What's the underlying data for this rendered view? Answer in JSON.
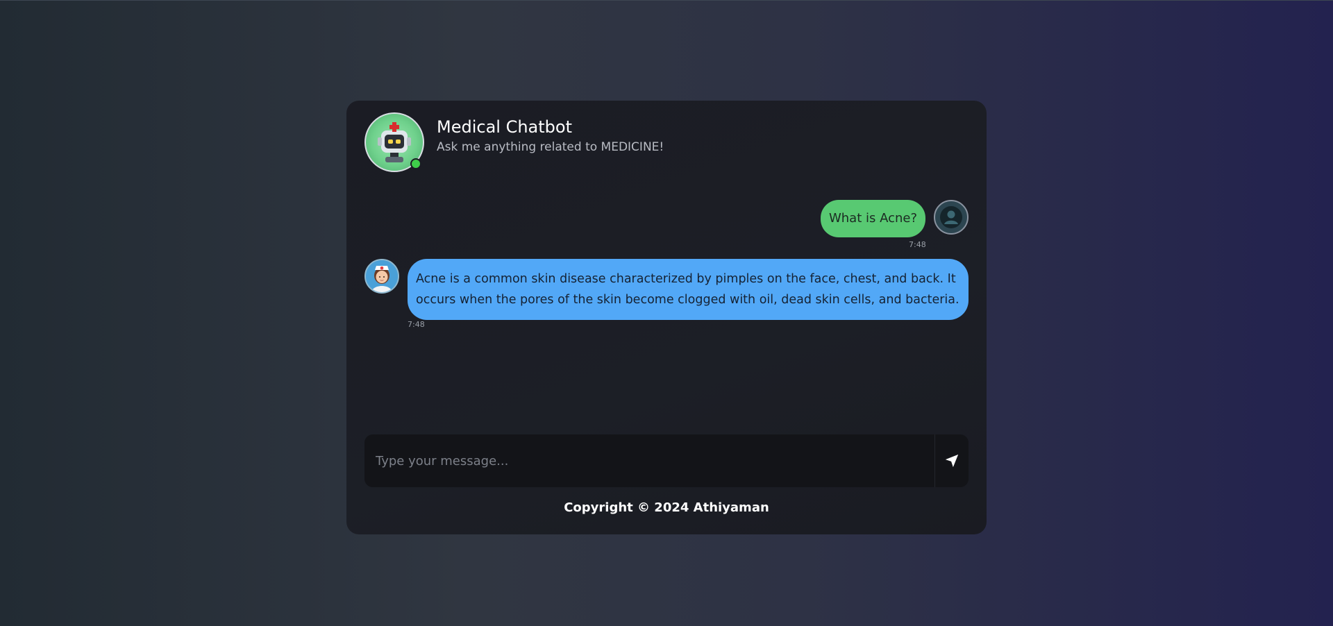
{
  "header": {
    "title": "Medical Chatbot",
    "subtitle": "Ask me anything related to MEDICINE!"
  },
  "messages": [
    {
      "sender": "user",
      "text": "What is Acne?",
      "time": "7:48"
    },
    {
      "sender": "bot",
      "text": "Acne is a common skin disease characterized by pimples on the face, chest, and back. It occurs when the pores of the skin become clogged with oil, dead skin cells, and bacteria.",
      "time": "7:48"
    }
  ],
  "input": {
    "placeholder": "Type your message...",
    "value": ""
  },
  "icons": {
    "bot_avatar": "robot-doctor-icon",
    "online_status": "online-dot",
    "user_avatar": "user-icon",
    "bot_message_avatar": "nurse-icon",
    "send": "send-icon"
  },
  "colors": {
    "user_bubble": "#58c972",
    "bot_bubble": "#52a8f7",
    "online": "#3fcf4a"
  },
  "footer": {
    "copyright": "Copyright © 2024 Athiyaman"
  }
}
